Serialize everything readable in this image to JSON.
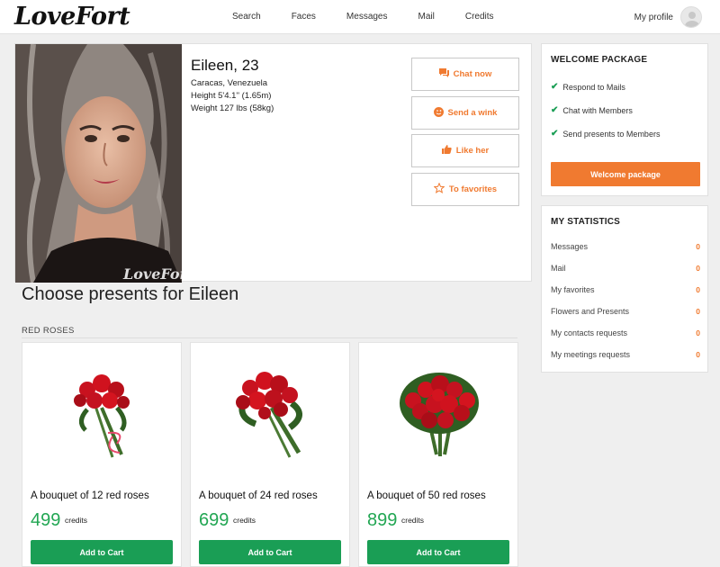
{
  "header": {
    "logo": "LoveFort",
    "nav": [
      "Search",
      "Faces",
      "Messages",
      "Mail",
      "Credits"
    ],
    "profile_label": "My profile"
  },
  "profile": {
    "name": "Eileen, 23",
    "location": "Caracas, Venezuela",
    "height": "Height 5'4.1'' (1.65m)",
    "weight": "Weight 127 lbs (58kg)",
    "photo_watermark": "LoveFort",
    "actions": [
      {
        "label": "Chat now",
        "icon": "chat-icon"
      },
      {
        "label": "Send a wink",
        "icon": "wink-icon"
      },
      {
        "label": "Like her",
        "icon": "thumbs-up-icon"
      },
      {
        "label": "To favorites",
        "icon": "star-icon"
      }
    ]
  },
  "presents": {
    "title": "Choose presents for Eileen",
    "section": "RED ROSES",
    "currency_label": "credits",
    "cart_label": "Add to Cart",
    "items": [
      {
        "name": "A bouquet of 12 red roses",
        "price": "499"
      },
      {
        "name": "A bouquet of 24 red roses",
        "price": "699"
      },
      {
        "name": "A bouquet of 50 red roses",
        "price": "899"
      }
    ]
  },
  "welcome": {
    "title": "WELCOME PACKAGE",
    "items": [
      "Respond to Mails",
      "Chat with Members",
      "Send presents to Members"
    ],
    "button": "Welcome package"
  },
  "stats": {
    "title": "MY STATISTICS",
    "rows": [
      {
        "label": "Messages",
        "value": "0"
      },
      {
        "label": "Mail",
        "value": "0"
      },
      {
        "label": "My favorites",
        "value": "0"
      },
      {
        "label": "Flowers and Presents",
        "value": "0"
      },
      {
        "label": "My contacts requests",
        "value": "0"
      },
      {
        "label": "My meetings requests",
        "value": "0"
      }
    ]
  },
  "colors": {
    "accent_orange": "#f07a30",
    "accent_green": "#1a9e55",
    "price_green": "#22a653"
  }
}
